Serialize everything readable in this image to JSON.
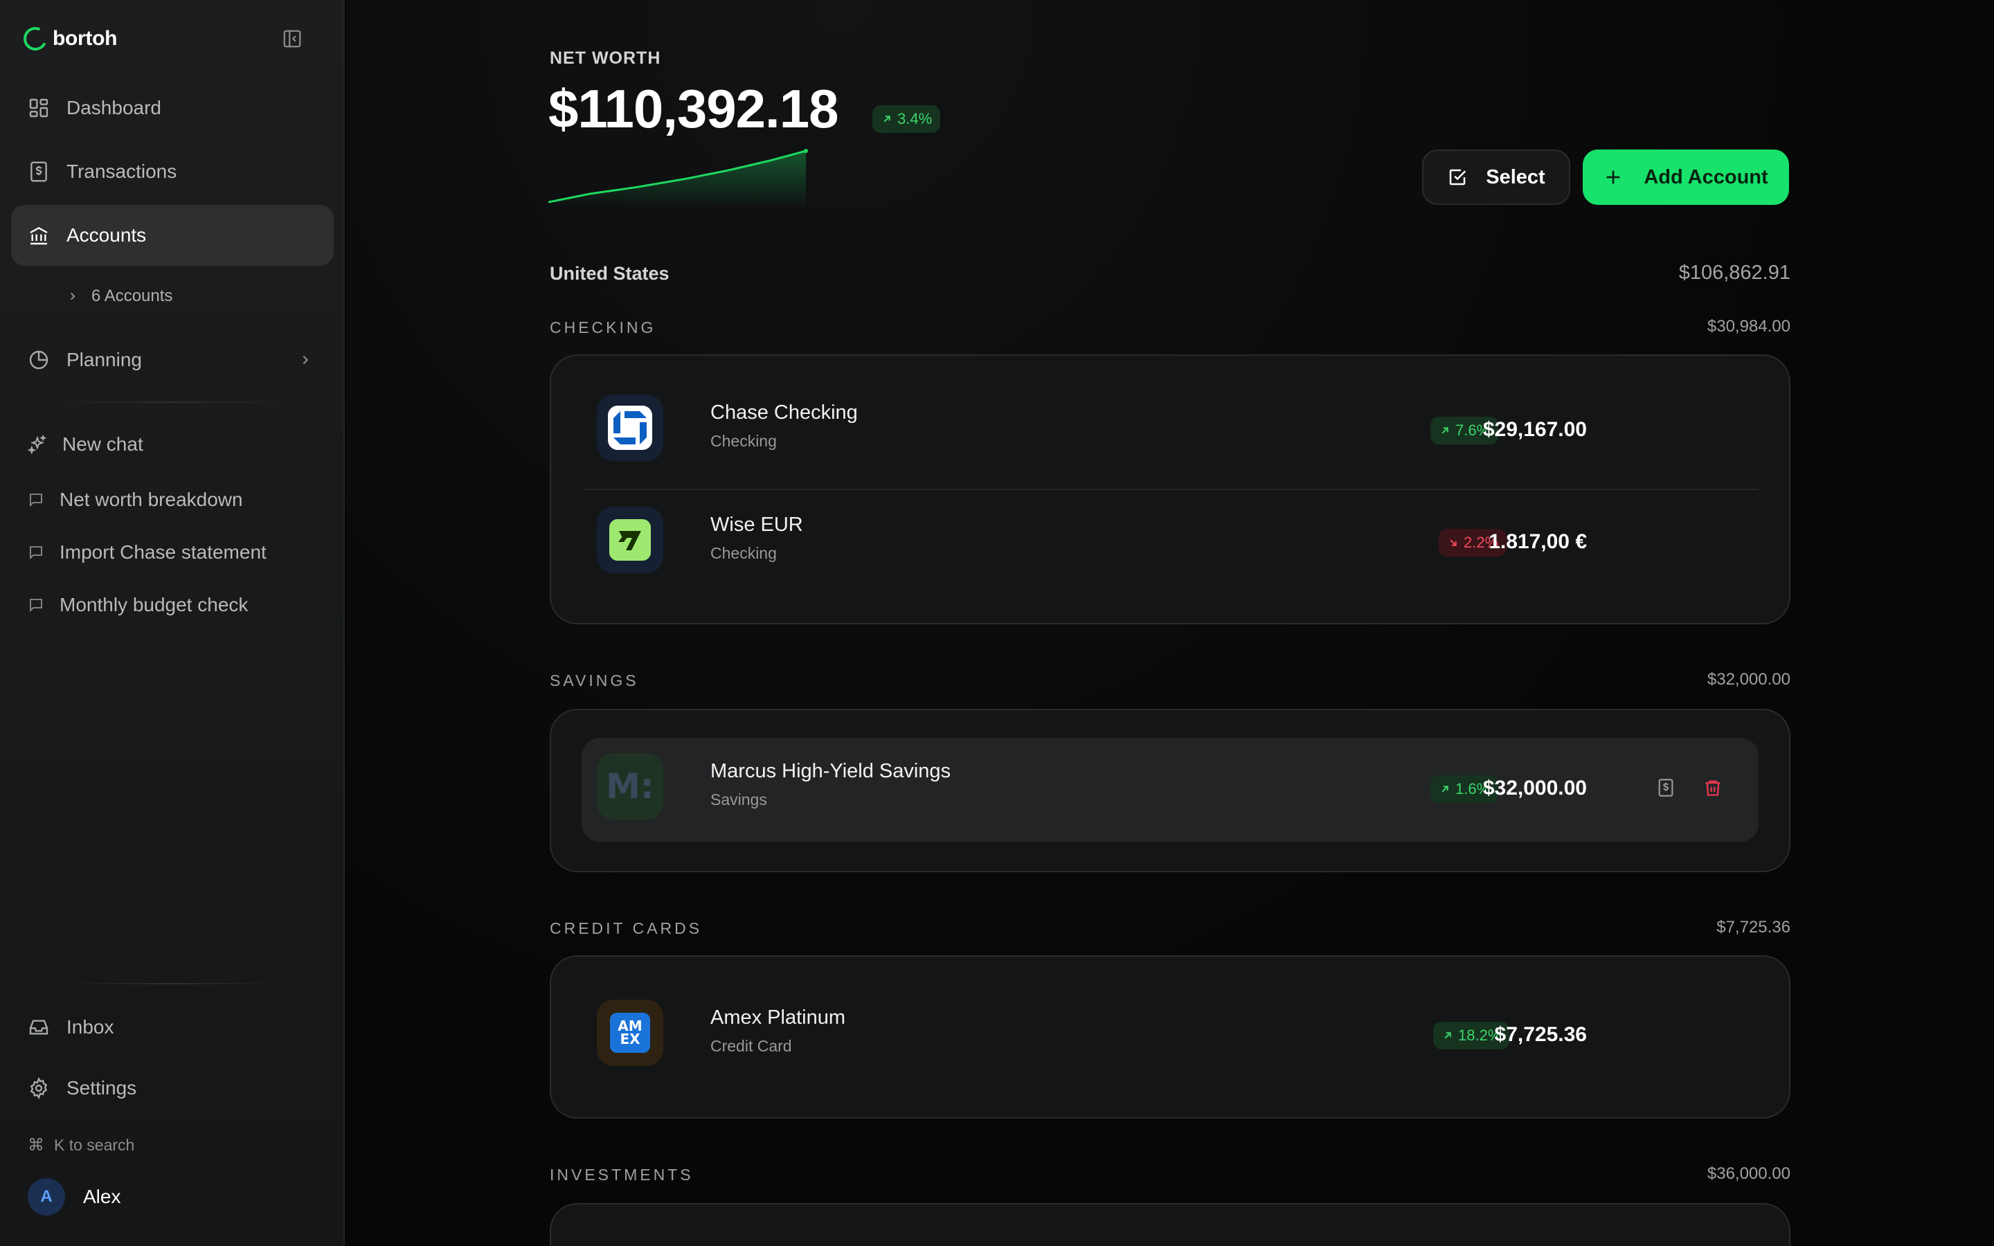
{
  "brand": {
    "name": "bortoh",
    "accent": "#1ed760"
  },
  "sidebar": {
    "nav": [
      {
        "label": "Dashboard",
        "icon": "dashboard-icon"
      },
      {
        "label": "Transactions",
        "icon": "receipt-icon"
      },
      {
        "label": "Accounts",
        "icon": "bank-icon",
        "active": true
      }
    ],
    "accounts_sub": "6 Accounts",
    "planning": "Planning",
    "new_chat": "New chat",
    "chats": [
      "Net worth breakdown",
      "Import Chase statement",
      "Monthly budget check"
    ],
    "inbox": "Inbox",
    "settings": "Settings",
    "search_hint": "K to search",
    "user": {
      "initial": "A",
      "name": "Alex"
    }
  },
  "summary": {
    "label": "NET WORTH",
    "value": "$110,392.18",
    "change": "3.4%",
    "select_label": "Select",
    "add_label": "Add Account"
  },
  "region": {
    "name": "United States",
    "total": "$106,862.91"
  },
  "groups": {
    "checking": {
      "label": "CHECKING",
      "total": "$30,984.00"
    },
    "savings": {
      "label": "SAVINGS",
      "total": "$32,000.00"
    },
    "credit": {
      "label": "CREDIT CARDS",
      "total": "$7,725.36"
    },
    "investments": {
      "label": "INVESTMENTS",
      "total": "$36,000.00"
    }
  },
  "accounts": {
    "chase": {
      "name": "Chase Checking",
      "type": "Checking",
      "change": "7.6%",
      "amount": "$29,167.00",
      "direction": "up"
    },
    "wise": {
      "name": "Wise EUR",
      "type": "Checking",
      "change": "2.2%",
      "amount": "1.817,00 €",
      "direction": "down"
    },
    "marcus": {
      "name": "Marcus High-Yield Savings",
      "type": "Savings",
      "change": "1.6%",
      "amount": "$32,000.00",
      "direction": "up",
      "logo_text": "M:"
    },
    "amex": {
      "name": "Amex Platinum",
      "type": "Credit Card",
      "change": "18.2%",
      "amount": "$7,725.36",
      "direction": "up",
      "logo_text": "AM EX"
    }
  }
}
